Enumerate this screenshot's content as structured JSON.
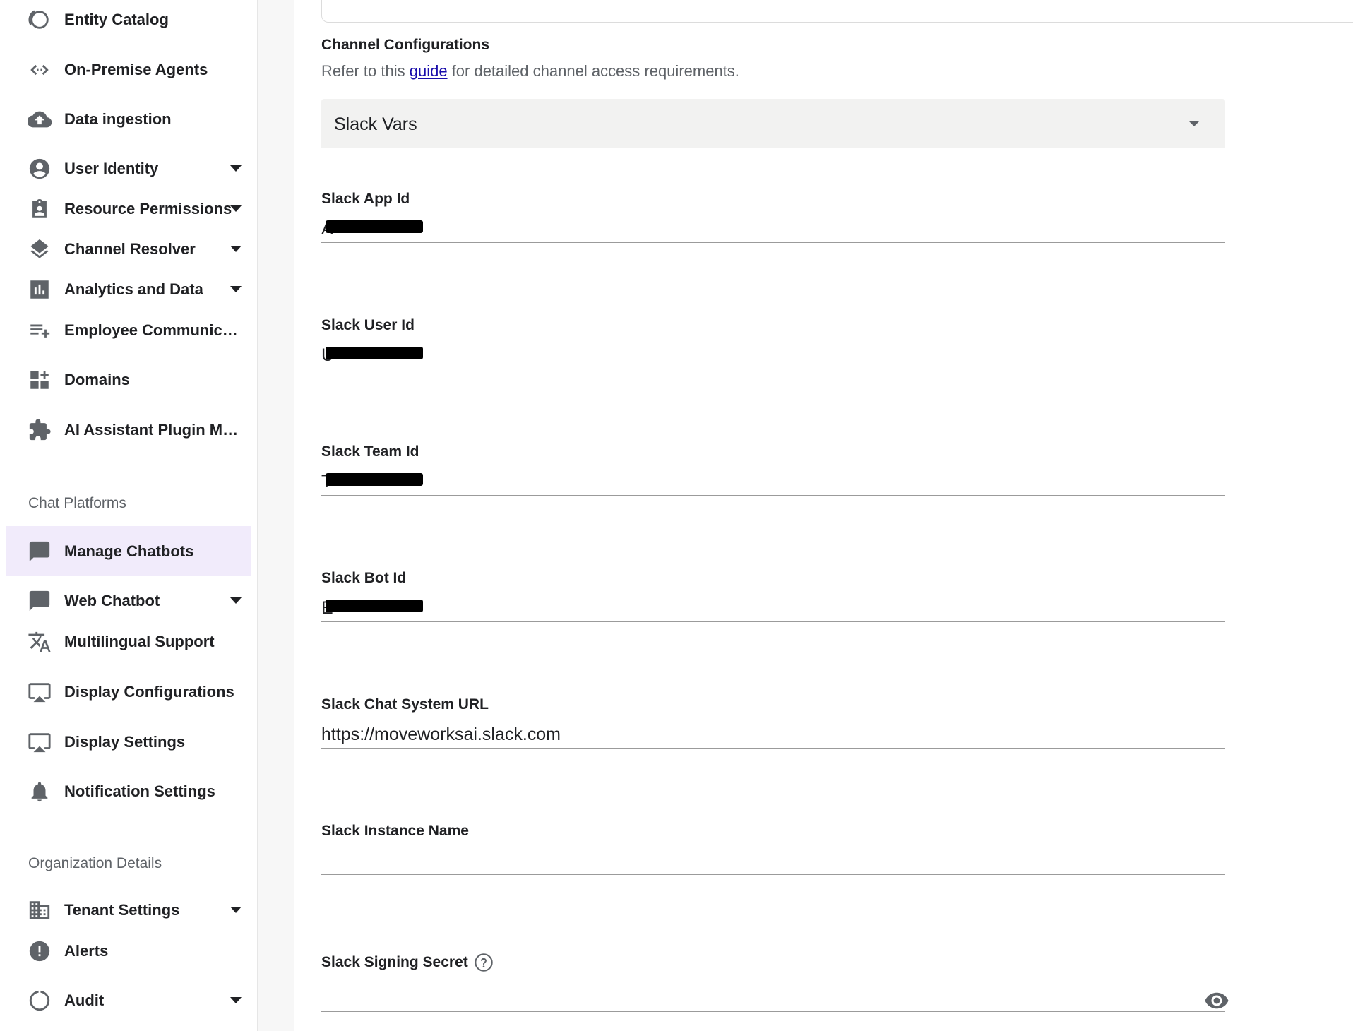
{
  "sidebar": {
    "items": [
      {
        "label": "Entity Catalog",
        "icon": "entity-catalog-icon"
      },
      {
        "label": "On-Premise Agents",
        "icon": "code-arrows-icon"
      },
      {
        "label": "Data ingestion",
        "icon": "cloud-upload-icon"
      },
      {
        "label": "User Identity",
        "icon": "account-circle-icon"
      },
      {
        "label": "Resource Permissions",
        "icon": "badge-icon"
      },
      {
        "label": "Channel Resolver",
        "icon": "layers-icon"
      },
      {
        "label": "Analytics and Data",
        "icon": "bar-chart-icon"
      },
      {
        "label": "Employee Communic…",
        "icon": "playlist-add-icon"
      },
      {
        "label": "Domains",
        "icon": "dashboard-customize-icon"
      },
      {
        "label": "AI Assistant Plugin M…",
        "icon": "extension-icon"
      }
    ],
    "section_chat": "Chat Platforms",
    "chat_items": [
      {
        "label": "Manage Chatbots",
        "icon": "chat-bubble-icon"
      },
      {
        "label": "Web Chatbot",
        "icon": "chat-bubble-icon"
      },
      {
        "label": "Multilingual Support",
        "icon": "translate-icon"
      },
      {
        "label": "Display Configurations",
        "icon": "airplay-icon"
      },
      {
        "label": "Display Settings",
        "icon": "airplay-icon"
      },
      {
        "label": "Notification Settings",
        "icon": "bell-icon"
      }
    ],
    "section_org": "Organization Details",
    "org_items": [
      {
        "label": "Tenant Settings",
        "icon": "building-icon"
      },
      {
        "label": "Alerts",
        "icon": "alert-icon"
      },
      {
        "label": "Audit",
        "icon": "audit-circle-icon"
      }
    ]
  },
  "main": {
    "section_title": "Channel Configurations",
    "desc_before": "Refer to this ",
    "desc_link": "guide",
    "desc_after": " for detailed channel access requirements.",
    "select_value": "Slack Vars",
    "fields": [
      {
        "label": "Slack App Id",
        "value": "A",
        "redacted": true
      },
      {
        "label": "Slack User Id",
        "value": "U",
        "redacted": true
      },
      {
        "label": "Slack Team Id",
        "value": "T",
        "redacted": true
      },
      {
        "label": "Slack Bot Id",
        "value": "E",
        "redacted": true
      },
      {
        "label": "Slack Chat System URL",
        "value": "https://moveworksai.slack.com"
      },
      {
        "label": "Slack Instance Name",
        "value": ""
      },
      {
        "label": "Slack Signing Secret",
        "value": ""
      }
    ]
  },
  "colors": {
    "active_bg": "#f1ebfb",
    "link": "#1a0dab",
    "icon": "#5f6368"
  }
}
